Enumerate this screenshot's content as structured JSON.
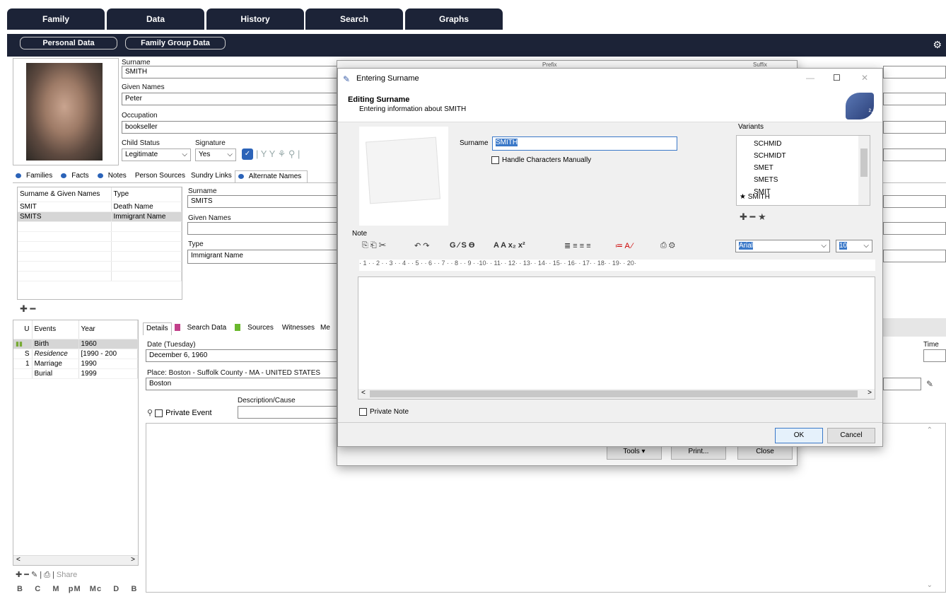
{
  "nav": {
    "tabs": [
      "Family",
      "Data",
      "History",
      "Search",
      "Graphs"
    ],
    "sub": [
      "Personal Data",
      "Family Group Data"
    ]
  },
  "person": {
    "surname_label": "Surname",
    "surname": "SMITH",
    "given_label": "Given Names",
    "given": "Peter",
    "occupation_label": "Occupation",
    "occupation": "bookseller",
    "child_status_label": "Child Status",
    "child_status": "Legitimate",
    "signature_label": "Signature",
    "signature": "Yes"
  },
  "person_tabs": [
    "Families",
    "Facts",
    "Notes",
    "Person Sources",
    "Sundry Links",
    "Alternate Names"
  ],
  "altnames": {
    "headers": [
      "Surname & Given Names",
      "Type"
    ],
    "rows": [
      [
        "SMIT",
        "Death Name"
      ],
      [
        "SMITS",
        "Immigrant Name"
      ]
    ],
    "surname_label": "Surname",
    "surname": "SMITS",
    "given_label": "Given Names",
    "given": "",
    "type_label": "Type",
    "type": "Immigrant Name"
  },
  "events": {
    "headers": [
      "U",
      "Events",
      "Year"
    ],
    "rows": [
      [
        "",
        "Birth",
        "1960"
      ],
      [
        "S",
        "Residence",
        "[1990 - 200"
      ],
      [
        "1",
        "Marriage",
        "1990"
      ],
      [
        "",
        "Burial",
        "1999"
      ]
    ],
    "share_label": "Share",
    "footer_letters": [
      "B",
      "C",
      "M",
      "pM",
      "Mc",
      "D",
      "B"
    ]
  },
  "detail_tabs": [
    "Details",
    "Search Data",
    "Sources",
    "Witnesses",
    "Me"
  ],
  "detail": {
    "date_label": "Date (Tuesday)",
    "date": "December 6, 1960",
    "place_label": "Place: Boston - Suffolk County - MA - UNITED STATES",
    "place": "Boston",
    "desc_label": "Description/Cause",
    "private_event": "Private Event",
    "time_label": "Time"
  },
  "back_window": {
    "prefix_label": "Prefix",
    "suffix_label": "Suffix",
    "tools": "Tools",
    "print": "Print...",
    "close": "Close"
  },
  "dialog": {
    "title": "Entering Surname",
    "heading": "Editing Surname",
    "subheading": "Entering information about SMITH",
    "surname_label": "Surname",
    "surname": "SMITH",
    "handle_chars": "Handle Characters Manually",
    "variants_label": "Variants",
    "variants": [
      "SCHMID",
      "SCHMIDT",
      "SMET",
      "SMETS",
      "SMIT",
      "SMITH"
    ],
    "note_label": "Note",
    "font": "Arial",
    "font_size": "10",
    "ruler": "· 1 · · 2 · · 3 · · 4 · · 5 · · 6 · · 7 · · 8 · · 9 · ·10· · 11· · 12· · 13· · 14· · 15· · 16· · 17· · 18· · 19· · 20·",
    "private_note": "Private Note",
    "ok": "OK",
    "cancel": "Cancel"
  },
  "colors": {
    "nav_bg": "#1c2337",
    "accent": "#2b63b8",
    "selection": "#d6d6d6"
  }
}
